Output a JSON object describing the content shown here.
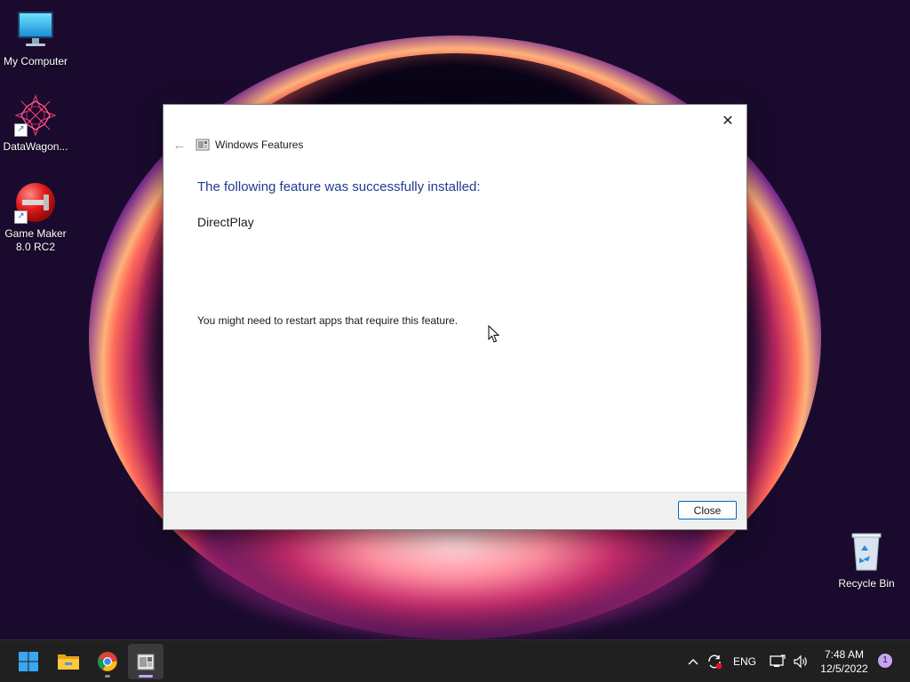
{
  "desktop": {
    "icons": [
      {
        "label": "My Computer",
        "icon": "monitor-icon"
      },
      {
        "label": "DataWagon...",
        "icon": "datawagon-icon"
      },
      {
        "label": "Game Maker 8.0 RC2",
        "icon": "game-maker-icon"
      },
      {
        "label": "Recycle Bin",
        "icon": "recycle-bin-icon"
      }
    ]
  },
  "dialog": {
    "title": "Windows Features",
    "heading": "The following feature was successfully installed:",
    "feature_name": "DirectPlay",
    "note": "You might need to restart apps that require this feature.",
    "close_button_label": "Close",
    "close_glyph": "✕",
    "back_glyph": "←"
  },
  "taskbar": {
    "apps": [
      {
        "name": "start",
        "icon": "windows-start-icon"
      },
      {
        "name": "file-explorer",
        "icon": "folder-icon"
      },
      {
        "name": "chrome",
        "icon": "chrome-icon"
      },
      {
        "name": "windows-features",
        "icon": "windows-features-icon",
        "active": true
      }
    ],
    "tray": {
      "chevron_glyph": "^",
      "language": "ENG",
      "time": "7:48 AM",
      "date": "12/5/2022",
      "notification_count": "1"
    }
  },
  "colors": {
    "accent": "#0067c0",
    "heading": "#1e3d8f",
    "taskbar": "#202020",
    "notification_badge": "#c9a4f2"
  }
}
